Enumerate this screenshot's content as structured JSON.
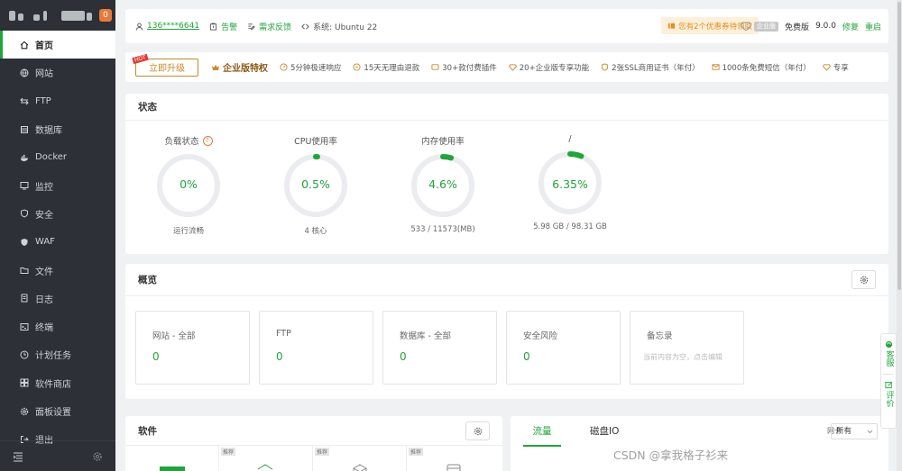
{
  "sidebar": {
    "badge": "0",
    "items": [
      {
        "label": "首页",
        "icon": "home-icon",
        "active": true
      },
      {
        "label": "网站",
        "icon": "globe-icon"
      },
      {
        "label": "FTP",
        "icon": "ftp-icon"
      },
      {
        "label": "数据库",
        "icon": "database-icon"
      },
      {
        "label": "Docker",
        "icon": "docker-icon"
      },
      {
        "label": "监控",
        "icon": "monitor-icon"
      },
      {
        "label": "安全",
        "icon": "shield-icon"
      },
      {
        "label": "WAF",
        "icon": "waf-icon"
      },
      {
        "label": "文件",
        "icon": "folder-icon"
      },
      {
        "label": "日志",
        "icon": "log-icon"
      },
      {
        "label": "终端",
        "icon": "terminal-icon"
      },
      {
        "label": "计划任务",
        "icon": "clock-icon"
      },
      {
        "label": "软件商店",
        "icon": "store-icon"
      },
      {
        "label": "面板设置",
        "icon": "settings-icon"
      },
      {
        "label": "退出",
        "icon": "logout-icon"
      }
    ]
  },
  "topbar": {
    "user": "136****6641",
    "alert": "告警",
    "feedback": "需求反馈",
    "system": "系统:  Ubuntu 22",
    "coupon": "您有2个优惠券待领取",
    "enterprise_tag": "企业版",
    "edition": "免费版",
    "version": "9.0.0",
    "repair": "修复",
    "restart": "重启"
  },
  "features": {
    "upgrade": "立即升级",
    "hot": "HOT",
    "title": "企业版特权",
    "items": [
      "5分钟极速响应",
      "15天无理由退款",
      "30+款付费插件",
      "20+企业版专享功能",
      "2张SSL商用证书（年付）",
      "1000条免费短信（年付）",
      "专享"
    ]
  },
  "status": {
    "title": "状态",
    "gauges": [
      {
        "title": "负载状态",
        "value": "0%",
        "sub": "运行流畅",
        "percent": 0,
        "help": "?"
      },
      {
        "title": "CPU使用率",
        "value": "0.5%",
        "sub": "4 核心",
        "percent": 0.5
      },
      {
        "title": "内存使用率",
        "value": "4.6%",
        "sub": "533 / 11573(MB)",
        "percent": 4.6
      },
      {
        "title": "/",
        "value": "6.35%",
        "sub": "5.98 GB / 98.31 GB",
        "percent": 6.35
      }
    ]
  },
  "overview": {
    "title": "概览",
    "cards": [
      {
        "title": "网站 - 全部",
        "value": "0"
      },
      {
        "title": "FTP",
        "value": "0"
      },
      {
        "title": "数据库 - 全部",
        "value": "0"
      },
      {
        "title": "安全风险",
        "value": "0"
      },
      {
        "title": "备忘录",
        "memo": "当前内容为空，点击编辑"
      }
    ]
  },
  "software": {
    "title": "软件",
    "tags": [
      "推荐",
      "推荐",
      "推荐"
    ]
  },
  "traffic": {
    "tabs": [
      "流量",
      "磁盘IO"
    ],
    "nic_label": "网卡",
    "nic_value": "所有"
  },
  "float": {
    "service": "客服",
    "review": "评价"
  },
  "watermark": "CSDN @拿我格子衫来"
}
